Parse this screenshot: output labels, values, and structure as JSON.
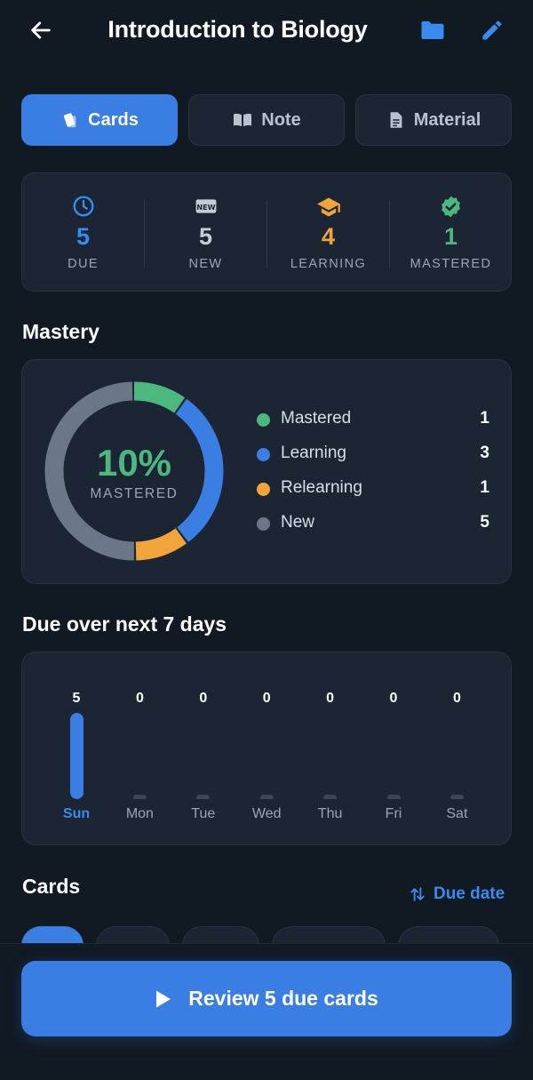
{
  "header": {
    "title": "Introduction to Biology",
    "back_icon": "arrow-left-icon",
    "folder_icon": "folder-icon",
    "edit_icon": "pencil-icon"
  },
  "tabs": [
    {
      "label": "Cards",
      "icon": "cards-icon",
      "active": true
    },
    {
      "label": "Note",
      "icon": "book-open-icon",
      "active": false
    },
    {
      "label": "Material",
      "icon": "document-icon",
      "active": false
    }
  ],
  "stats": [
    {
      "value": "5",
      "label": "DUE",
      "icon": "clock-icon",
      "color": "#3a8bf0"
    },
    {
      "value": "5",
      "label": "NEW",
      "icon": "new-badge-icon",
      "color": "#c4cdd8"
    },
    {
      "value": "4",
      "label": "LEARNING",
      "icon": "graduation-cap-icon",
      "color": "#f0a43a"
    },
    {
      "value": "1",
      "label": "MASTERED",
      "icon": "verified-badge-icon",
      "color": "#4cb87e"
    }
  ],
  "mastery": {
    "title": "Mastery",
    "percent_text": "10%",
    "percent_label": "MASTERED",
    "legend": [
      {
        "name": "Mastered",
        "value": "1",
        "color": "#4cb87e"
      },
      {
        "name": "Learning",
        "value": "3",
        "color": "#3a7ee4"
      },
      {
        "name": "Relearning",
        "value": "1",
        "color": "#f0a43a"
      },
      {
        "name": "New",
        "value": "5",
        "color": "#6b7789"
      }
    ]
  },
  "due_chart": {
    "title": "Due over next 7 days",
    "days": [
      {
        "day": "Sun",
        "count": "5",
        "highlight": true
      },
      {
        "day": "Mon",
        "count": "0",
        "highlight": false
      },
      {
        "day": "Tue",
        "count": "0",
        "highlight": false
      },
      {
        "day": "Wed",
        "count": "0",
        "highlight": false
      },
      {
        "day": "Thu",
        "count": "0",
        "highlight": false
      },
      {
        "day": "Fri",
        "count": "0",
        "highlight": false
      },
      {
        "day": "Sat",
        "count": "0",
        "highlight": false
      }
    ],
    "max": 5
  },
  "cards_section": {
    "title": "Cards",
    "sort_label": "Due date",
    "sort_icon": "sort-arrows-icon"
  },
  "review_button": {
    "label": "Review 5 due cards",
    "icon": "play-icon"
  },
  "colors": {
    "accent": "#3a7ee4",
    "background": "#111923",
    "card": "#1c2533"
  }
}
